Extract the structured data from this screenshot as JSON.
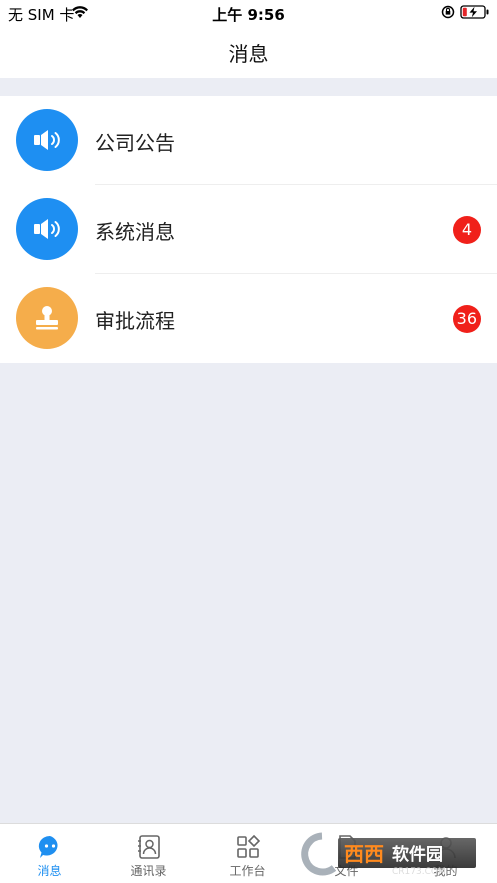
{
  "status_bar": {
    "carrier": "无 SIM 卡",
    "time": "上午 9:56"
  },
  "header": {
    "title": "消息"
  },
  "messages": [
    {
      "label": "公司公告",
      "icon": "speaker-icon",
      "color": "#1e8ff2",
      "badge": ""
    },
    {
      "label": "系统消息",
      "icon": "speaker-icon",
      "color": "#1e8ff2",
      "badge": "4"
    },
    {
      "label": "审批流程",
      "icon": "stamp-icon",
      "color": "#f5ad4b",
      "badge": "36"
    }
  ],
  "tabs": [
    {
      "label": "消息",
      "icon": "chat-icon",
      "active": true
    },
    {
      "label": "通讯录",
      "icon": "contacts-icon",
      "active": false
    },
    {
      "label": "工作台",
      "icon": "workbench-icon",
      "active": false
    },
    {
      "label": "文件",
      "icon": "file-icon",
      "active": false
    },
    {
      "label": "我的",
      "icon": "profile-icon",
      "active": false
    }
  ],
  "colors": {
    "accent": "#1f8ff0",
    "badge": "#f0201a",
    "background": "#ebedf4"
  },
  "watermark": {
    "text": "西西软件园",
    "subtext": "CR173.COM"
  }
}
